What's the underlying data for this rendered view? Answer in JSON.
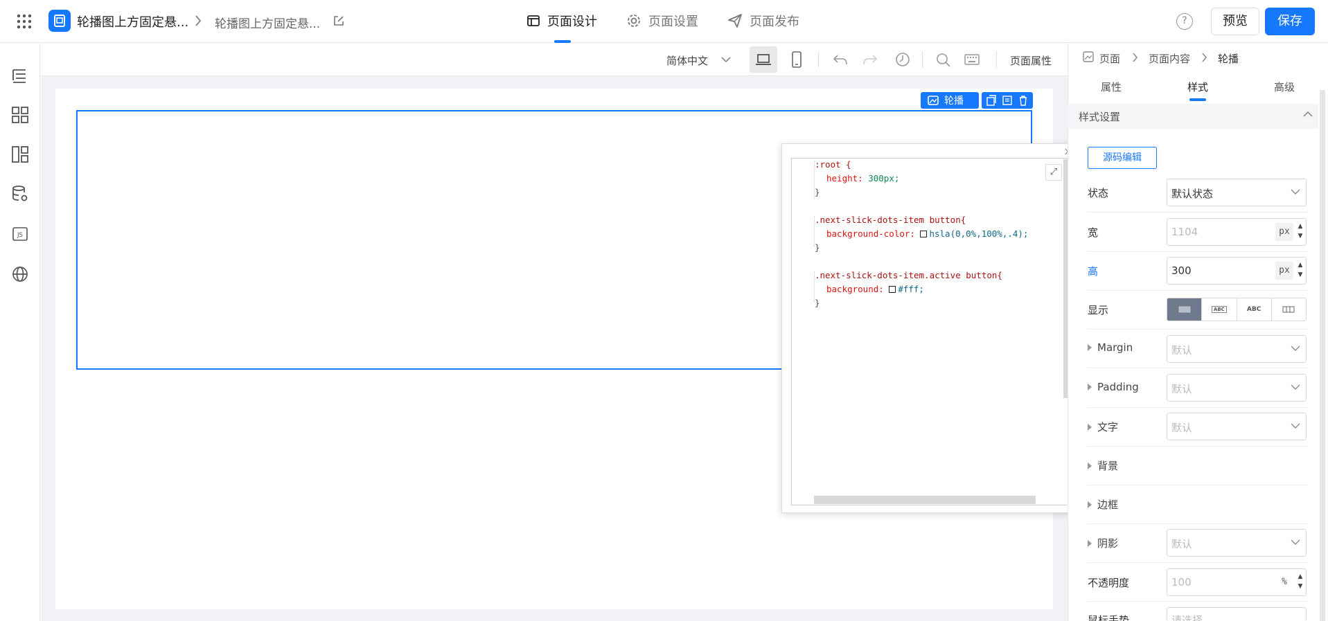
{
  "header": {
    "app_title": "轮播图上方固定悬...",
    "page_subtitle": "轮播图上方固定悬...",
    "tabs": [
      {
        "label": "页面设计",
        "icon": "browser-window-icon",
        "active": true
      },
      {
        "label": "页面设置",
        "icon": "gear-icon",
        "active": false
      },
      {
        "label": "页面发布",
        "icon": "paper-plane-icon",
        "active": false
      }
    ],
    "help_glyph": "?",
    "preview_label": "预览",
    "save_label": "保存",
    "accent_color": "#1677ff"
  },
  "left_sidebar": {
    "icons": [
      "outline-tree-icon",
      "components-grid-icon",
      "layout-icon",
      "datasource-icon",
      "js-code-icon",
      "globe-icon"
    ],
    "js_label": "JS"
  },
  "canvas_toolbar": {
    "language": "简体中文",
    "page_properties_label": "页面属性",
    "devices": [
      "desktop",
      "mobile"
    ],
    "actions": [
      "undo-icon",
      "redo-icon",
      "history-icon",
      "search-icon",
      "keyboard-icon"
    ]
  },
  "canvas": {
    "selected_component_label": "轮播",
    "component_actions": [
      "copy-icon",
      "save-as-icon",
      "delete-icon"
    ]
  },
  "code_editor": {
    "close_glyph": "×",
    "expand_glyph": "⤢",
    "lines": [
      {
        "sel": ":root {"
      },
      {
        "prop": "height:",
        "val": "300px;"
      },
      {
        "sel": "}"
      },
      {
        "sel": ""
      },
      {
        "sel": ".next-slick-dots-item button{"
      },
      {
        "prop": "background-color:",
        "swatch": true,
        "val": "hsla(0,0%,100%,.4);"
      },
      {
        "sel": "}"
      },
      {
        "sel": ""
      },
      {
        "sel": ".next-slick-dots-item.active button{"
      },
      {
        "prop": "background:",
        "swatch": true,
        "val": "#fff;"
      },
      {
        "sel": "}"
      }
    ]
  },
  "right_panel": {
    "breadcrumb": [
      "页面",
      "页面内容",
      "轮播"
    ],
    "tabs": [
      "属性",
      "样式",
      "高级"
    ],
    "active_tab": "样式",
    "section_title": "样式设置",
    "source_edit_label": "源码编辑",
    "state": {
      "label": "状态",
      "value": "默认状态"
    },
    "width": {
      "label": "宽",
      "value": "1104",
      "unit": "px"
    },
    "height": {
      "label": "高",
      "value": "300",
      "unit": "px"
    },
    "display": {
      "label": "显示",
      "options": [
        "block",
        "ABC",
        "ABC",
        "flex"
      ]
    },
    "margin": {
      "label": "Margin",
      "value": "默认"
    },
    "padding": {
      "label": "Padding",
      "value": "默认"
    },
    "text": {
      "label": "文字",
      "value": "默认"
    },
    "background": {
      "label": "背景"
    },
    "border": {
      "label": "边框"
    },
    "shadow": {
      "label": "阴影",
      "value": "默认"
    },
    "opacity": {
      "label": "不透明度",
      "value": "100",
      "unit": "%"
    },
    "cursor": {
      "label": "鼠标手势",
      "value": "请选择"
    },
    "spin_up": "▲",
    "spin_down": "▼"
  }
}
